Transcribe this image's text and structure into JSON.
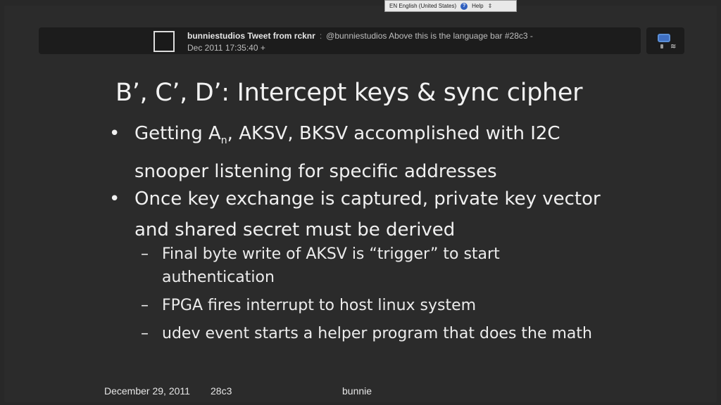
{
  "language_bar": {
    "language": "EN English (United States)",
    "help_label": "Help"
  },
  "notification": {
    "title": "bunniestudios Tweet from rcknr",
    "separator": ":",
    "body": "@bunniestudios Above this is the language bar #28c3 -",
    "timestamp": "Dec 2011 17:35:40 +"
  },
  "slide": {
    "title": "B’, C’, D’: Intercept keys & sync cipher",
    "bullets": [
      {
        "prefix": "Getting A",
        "subscript": "n",
        "suffix": ", AKSV, BKSV accomplished with I2C snooper listening for specific addresses"
      },
      {
        "text": "Once key exchange is captured, private key vector and shared secret must be derived"
      }
    ],
    "subbullets": [
      "Final byte write of AKSV is “trigger” to start authentication",
      "FPGA fires interrupt to host linux system",
      "udev event starts a helper program that does the math"
    ]
  },
  "footer": {
    "date": "December 29, 2011",
    "event": "28c3",
    "author": "bunnie"
  },
  "colors": {
    "background": "#2b2b2b",
    "text": "#f0f0f0",
    "notification_bg": "#1c1c1c"
  }
}
